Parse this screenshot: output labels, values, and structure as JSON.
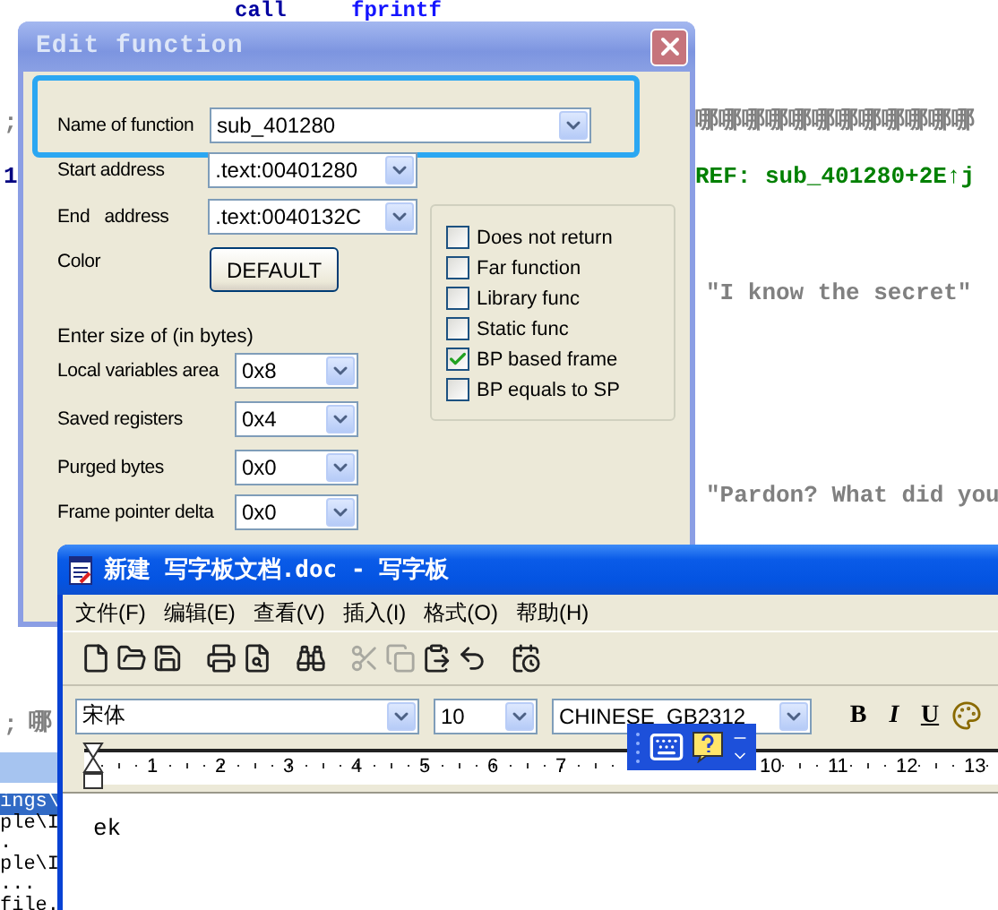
{
  "disassembly": [
    {
      "kind": "instruction",
      "text": "call"
    },
    {
      "kind": "operand",
      "text": "fprintf"
    },
    {
      "kind": "comment",
      "text": ";"
    },
    {
      "kind": "comment",
      "text": "哪哪哪哪哪哪哪哪哪哪哪哪"
    },
    {
      "kind": "label",
      "text": "1"
    },
    {
      "kind": "xref",
      "text": "REF: sub_401280+2E↑j"
    },
    {
      "kind": "string",
      "text": "\"I know the secret\""
    },
    {
      "kind": "string",
      "text": "\"Pardon? What did you"
    },
    {
      "kind": "comment",
      "text": ";"
    },
    {
      "kind": "comment",
      "text": "哪"
    }
  ],
  "path_list": {
    "items": [
      {
        "text": "ings\\",
        "selected": true
      },
      {
        "text": "ple\\I",
        "selected": false
      },
      {
        "text": ".",
        "selected": false
      },
      {
        "text": "ple\\I",
        "selected": false
      },
      {
        "text": "...",
        "selected": false
      },
      {
        "text": "file.",
        "selected": false
      }
    ]
  },
  "edit_dialog": {
    "title": "Edit function",
    "name_field": {
      "label": "Name of function",
      "value": "sub_401280"
    },
    "address_fields": [
      {
        "label": "Start address",
        "value": ".text:00401280"
      },
      {
        "label": "End   address",
        "value": ".text:0040132C"
      }
    ],
    "color": {
      "label": "Color",
      "button": "DEFAULT"
    },
    "size_heading": "Enter size of (in bytes)",
    "size_fields": [
      {
        "label": "Local variables area",
        "value": "0x8"
      },
      {
        "label": "Saved registers",
        "value": "0x4"
      },
      {
        "label": "Purged bytes",
        "value": "0x0"
      },
      {
        "label": "Frame pointer delta",
        "value": "0x0"
      }
    ],
    "options": [
      {
        "label": "Does not return",
        "checked": false
      },
      {
        "label": "Far function",
        "checked": false
      },
      {
        "label": "Library func",
        "checked": false
      },
      {
        "label": "Static func",
        "checked": false
      },
      {
        "label": "BP based frame",
        "checked": true
      },
      {
        "label": "BP equals to SP",
        "checked": false
      }
    ]
  },
  "wordpad": {
    "title": "新建 写字板文档.doc - 写字板",
    "menu": [
      "文件(F)",
      "编辑(E)",
      "查看(V)",
      "插入(I)",
      "格式(O)",
      "帮助(H)"
    ],
    "tools": [
      {
        "kind": "new",
        "disabled": false
      },
      {
        "kind": "open",
        "disabled": false
      },
      {
        "kind": "save",
        "disabled": false
      },
      {
        "kind": "print",
        "disabled": false
      },
      {
        "kind": "preview",
        "disabled": false
      },
      {
        "kind": "find",
        "disabled": false
      },
      {
        "kind": "cut",
        "disabled": true
      },
      {
        "kind": "copy",
        "disabled": true
      },
      {
        "kind": "paste",
        "disabled": false
      },
      {
        "kind": "undo",
        "disabled": false
      },
      {
        "kind": "datetime",
        "disabled": false
      }
    ],
    "font": "宋体",
    "size": "10",
    "script": "CHINESE_GB2312",
    "style_buttons": [
      {
        "kind": "bold",
        "text": "B"
      },
      {
        "kind": "italic",
        "text": "I"
      },
      {
        "kind": "underline",
        "text": "U"
      }
    ],
    "ruler": [
      "1",
      "2",
      "3",
      "4",
      "5",
      "6",
      "7",
      "10",
      "11",
      "12",
      "13"
    ],
    "document_text": "ek"
  }
}
